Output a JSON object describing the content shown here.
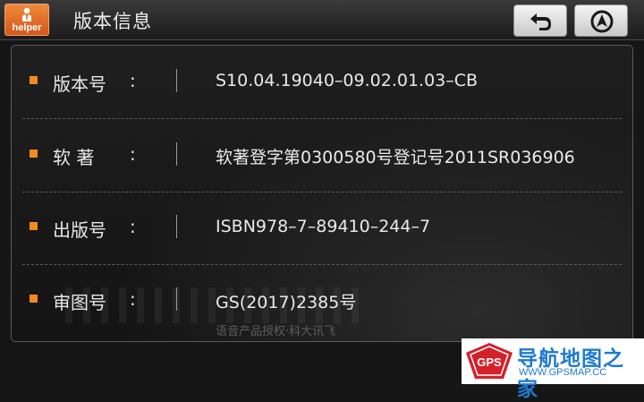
{
  "header": {
    "app_icon_label": "helper",
    "title": "版本信息",
    "back_icon": "back-icon",
    "navigate_icon": "navigation-arrow-icon"
  },
  "info": {
    "rows": [
      {
        "label": "版本号",
        "colon": ":",
        "value": "S10.04.19040–09.02.01.03–CB"
      },
      {
        "label": "软 著",
        "colon": ":",
        "value": "软著登字第0300580号登记号2011SR036906"
      },
      {
        "label": "出版号",
        "colon": ":",
        "value": "ISBN978–7–89410–244–7"
      },
      {
        "label": "审图号",
        "colon": ":",
        "value": "GS(2017)2385号"
      }
    ],
    "footer_note": "语音产品授权·科大讯飞"
  },
  "watermark": {
    "badge_text": "GPS",
    "site_name": "导航地图之家",
    "url": "WWW.GPSMAP.CC"
  },
  "colors": {
    "accent": "#f28a1e",
    "logo_blue": "#1f7ad1",
    "logo_red": "#d51f2a"
  }
}
